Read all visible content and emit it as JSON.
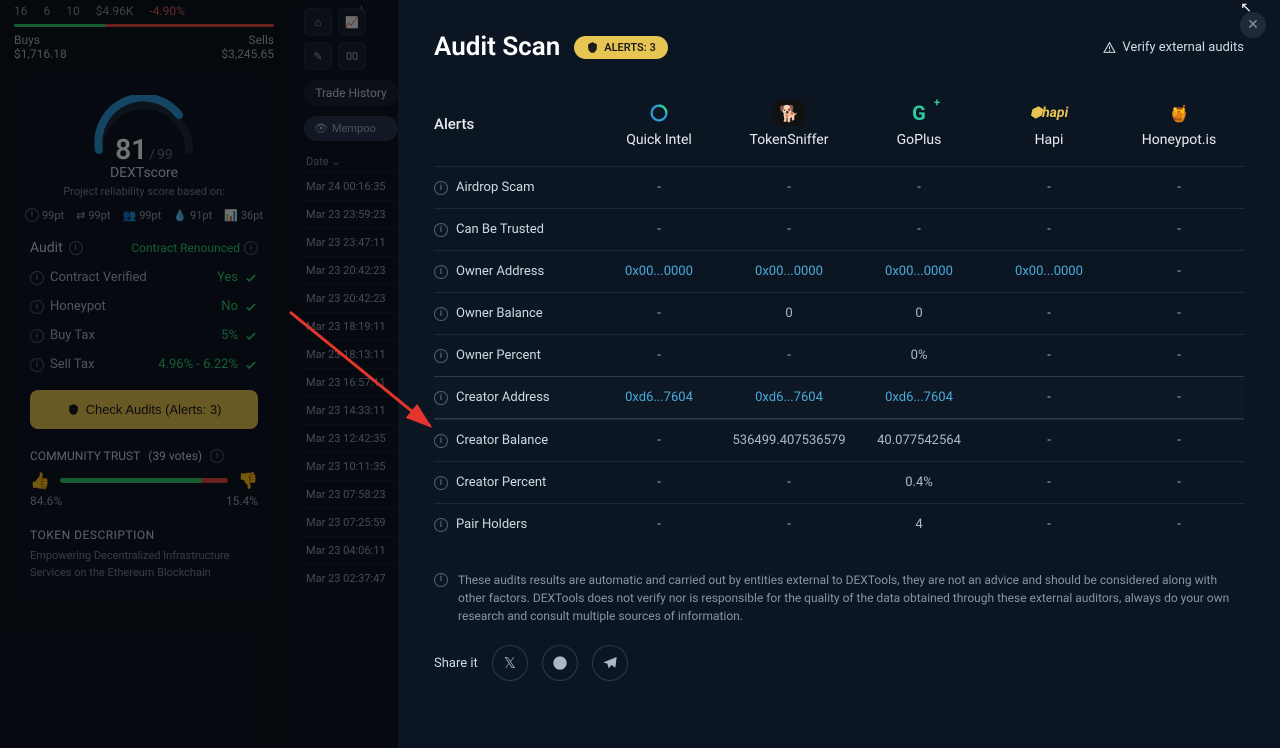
{
  "top_bar": {
    "n1": "16",
    "n2": "6",
    "n3": "10",
    "amount": "$4.96K",
    "pct": "-4.90%"
  },
  "buys_sells": {
    "buys_label": "Buys",
    "buys_amount": "$1,716.18",
    "sells_label": "Sells",
    "sells_amount": "$3,245.65"
  },
  "dext": {
    "score": "81",
    "divider": "/",
    "max": "99",
    "label": "DEXTscore",
    "sub": "Project reliability score based on:",
    "points": [
      "99pt",
      "99pt",
      "99pt",
      "91pt",
      "36pt"
    ]
  },
  "audit_sidebar": {
    "label": "Audit",
    "renounced": "Contract Renounced",
    "rows": [
      {
        "label": "Contract Verified",
        "value": "Yes",
        "cls": "green"
      },
      {
        "label": "Honeypot",
        "value": "No",
        "cls": "green"
      },
      {
        "label": "Buy Tax",
        "value": "5%",
        "cls": "green"
      },
      {
        "label": "Sell Tax",
        "value": "4.96% - 6.22%",
        "cls": "green"
      }
    ],
    "button": "Check Audits   (Alerts: 3)"
  },
  "community": {
    "label": "COMMUNITY TRUST",
    "votes": "(39 votes)",
    "up": "84.6%",
    "down": "15.4%"
  },
  "token_desc": {
    "label": "TOKEN DESCRIPTION",
    "text": "Empowering Decentralized Infrastructure Services on the Ethereum Blockchain"
  },
  "trade": {
    "tab": "Trade History",
    "mempool": "Mempoo",
    "tv": "00",
    "date_label": "Date ⌄",
    "dates": [
      "Mar 24 00:16:35",
      "Mar 23 23:59:23",
      "Mar 23 23:47:11",
      "Mar 23 20:42:23",
      "Mar 23 20:42:23",
      "Mar 23 18:19:11",
      "Mar 23 18:13:11",
      "Mar 23 16:57:11",
      "Mar 23 14:33:11",
      "Mar 23 12:42:35",
      "Mar 23 10:11:35",
      "Mar 23 07:58:23",
      "Mar 23 07:25:59",
      "Mar 23 04:06:11",
      "Mar 23 02:37:47"
    ]
  },
  "modal": {
    "title": "Audit Scan",
    "alert_pill": "ALERTS: 3",
    "verify": "Verify external audits",
    "alerts_label": "Alerts",
    "auditors": [
      "Quick Intel",
      "TokenSniffer",
      "GoPlus",
      "Hapi",
      "Honeypot.is"
    ],
    "rows": [
      {
        "label": "Airdrop Scam",
        "cells": [
          "-",
          "-",
          "-",
          "-",
          "-"
        ]
      },
      {
        "label": "Can Be Trusted",
        "cells": [
          "-",
          "-",
          "-",
          "-",
          "-"
        ]
      },
      {
        "label": "Owner Address",
        "cells": [
          "0x00...0000",
          "0x00...0000",
          "0x00...0000",
          "0x00...0000",
          "-"
        ],
        "link": [
          true,
          true,
          true,
          true,
          false
        ]
      },
      {
        "label": "Owner Balance",
        "cells": [
          "-",
          "0",
          "0",
          "-",
          "-"
        ]
      },
      {
        "label": "Owner Percent",
        "cells": [
          "-",
          "-",
          "0%",
          "-",
          "-"
        ]
      },
      {
        "label": "Creator Address",
        "cells": [
          "0xd6...7604",
          "0xd6...7604",
          "0xd6...7604",
          "-",
          "-"
        ],
        "link": [
          true,
          true,
          true,
          false,
          false
        ],
        "hl": true
      },
      {
        "label": "Creator Balance",
        "cells": [
          "-",
          "536499.407536579",
          "40.077542564",
          "-",
          "-"
        ]
      },
      {
        "label": "Creator Percent",
        "cells": [
          "-",
          "-",
          "0.4%",
          "-",
          "-"
        ]
      },
      {
        "label": "Pair Holders",
        "cells": [
          "-",
          "-",
          "4",
          "-",
          "-"
        ]
      }
    ],
    "disclaimer": "These audits results are automatic and carried out by entities external to DEXTools, they are not an advice and should be considered along with other factors. DEXTools does not verify nor is responsible for the quality of the data obtained through these external auditors, always do your own research and consult multiple sources of information.",
    "share_label": "Share it"
  }
}
